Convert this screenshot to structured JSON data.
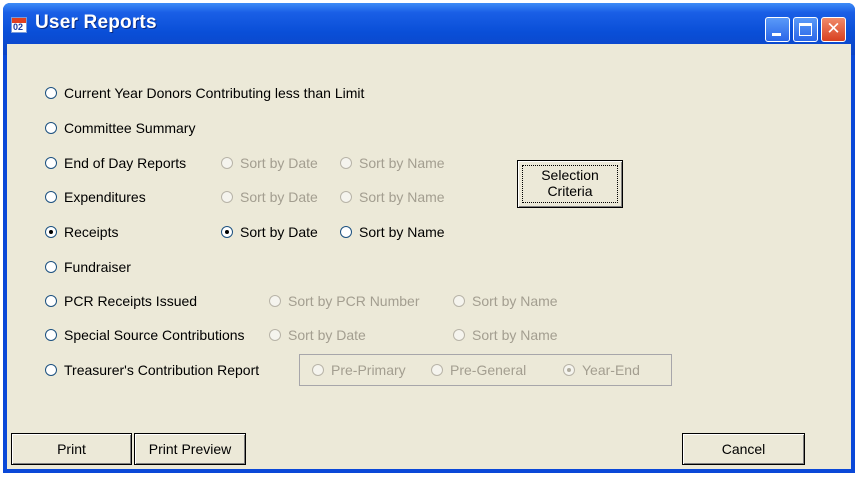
{
  "window": {
    "title": "User Reports",
    "icon": "calendar-app-icon",
    "icon_text": "02"
  },
  "reports": [
    {
      "label": "Current Year Donors Contributing less than Limit",
      "selected": false
    },
    {
      "label": "Committee Summary",
      "selected": false
    },
    {
      "label": "End of Day Reports",
      "selected": false
    },
    {
      "label": "Expenditures",
      "selected": false
    },
    {
      "label": "Receipts",
      "selected": true
    },
    {
      "label": "Fundraiser",
      "selected": false
    },
    {
      "label": "PCR Receipts Issued",
      "selected": false
    },
    {
      "label": "Special Source Contributions",
      "selected": false
    },
    {
      "label": "Treasurer's Contribution Report",
      "selected": false
    }
  ],
  "sort_options": {
    "end_of_day": {
      "date": "Sort by Date",
      "name": "Sort by Name",
      "enabled": false,
      "selected": null
    },
    "expenditures": {
      "date": "Sort by Date",
      "name": "Sort by Name",
      "enabled": false,
      "selected": null
    },
    "receipts": {
      "date": "Sort by Date",
      "name": "Sort by Name",
      "enabled": true,
      "selected": "date"
    },
    "pcr": {
      "number": "Sort by PCR Number",
      "name": "Sort by Name",
      "enabled": false,
      "selected": null
    },
    "special_source": {
      "date": "Sort by Date",
      "name": "Sort by Name",
      "enabled": false,
      "selected": null
    }
  },
  "treasurer_options": {
    "items": [
      "Pre-Primary",
      "Pre-General",
      "Year-End"
    ],
    "selected": "Year-End",
    "enabled": false
  },
  "buttons": {
    "selection_criteria_line1": "Selection",
    "selection_criteria_line2": "Criteria",
    "print": "Print",
    "print_preview": "Print Preview",
    "cancel": "Cancel"
  },
  "colors": {
    "titlebar": "#0a4fd8",
    "client": "#ece9d8",
    "disabled_text": "#a39e90"
  }
}
